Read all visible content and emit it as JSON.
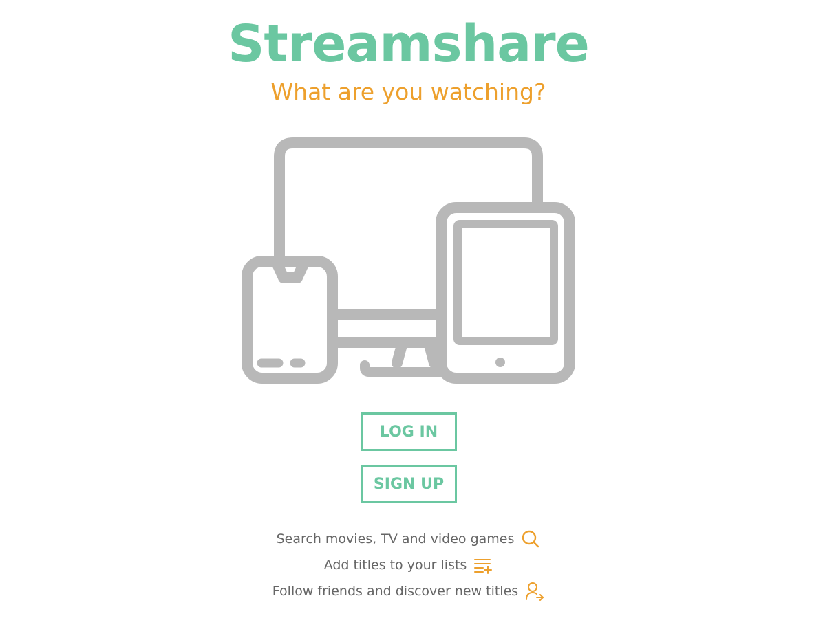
{
  "brand": {
    "title": "Streamshare",
    "tagline": "What are you watching?"
  },
  "colors": {
    "brand_green": "#6bc7a1",
    "accent_orange": "#eda02d",
    "illustration_gray": "#b8b8b8",
    "text_gray": "#666666"
  },
  "hero": {
    "icon": "devices-icon"
  },
  "actions": {
    "login_label": "LOG IN",
    "signup_label": "SIGN UP"
  },
  "features": [
    {
      "text": "Search movies, TV and video games",
      "icon": "search-icon"
    },
    {
      "text": "Add titles to your lists",
      "icon": "playlist-add-icon"
    },
    {
      "text": "Follow friends and discover new titles",
      "icon": "user-follow-icon"
    }
  ]
}
